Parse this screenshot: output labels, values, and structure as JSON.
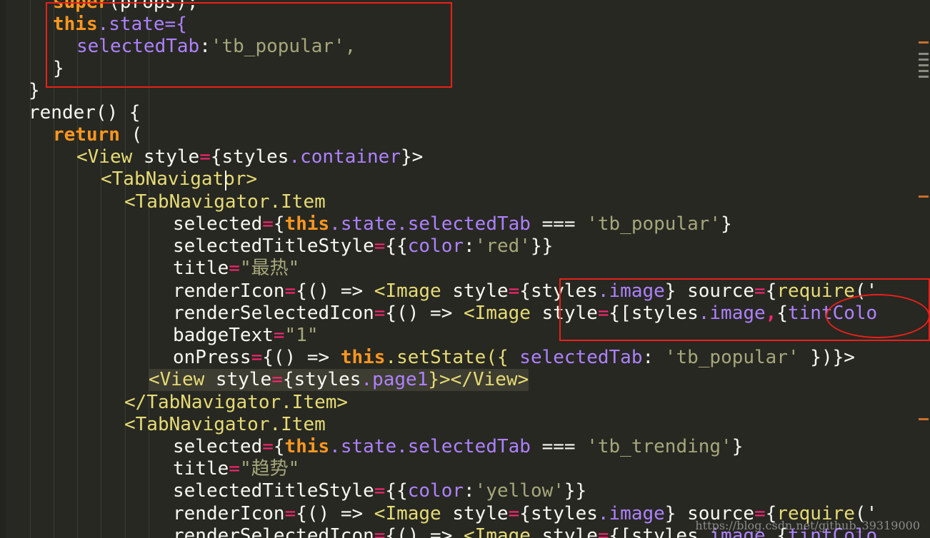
{
  "editor": {
    "lines": {
      "l00_a": "super",
      "l00_b": "(props);",
      "l01_this": "this",
      "l01_rest": ".state={",
      "l02_key": "selectedTab",
      "l02_colon": ":",
      "l02_val": "'tb_popular',",
      "l03": "}",
      "l04": "}",
      "l05": "render() {",
      "l06_kw": "return",
      "l06_rest": " (",
      "l07_open": "<View",
      "l07_attr": " style",
      "l07_eq": "=",
      "l07_a": "{styles",
      "l07_b": ".container",
      "l07_c": "}>",
      "l08_a": "<TabNaviga",
      "l08_b": "tor>",
      "l09": "<TabNavigator.Item",
      "l10_attr": "selected",
      "l10_eq": "=",
      "l10_br": "{",
      "l10_this": "this",
      "l10_prop": ".state.selectedTab",
      "l10_op": " === ",
      "l10_str": "'tb_popular'",
      "l10_end": "}",
      "l11_attr": "selectedTitleStyle",
      "l11_eq": "=",
      "l11_a": "{{",
      "l11_key": "color",
      "l11_colon": ":",
      "l11_str": "'red'",
      "l11_end": "}}",
      "l12_attr": "title",
      "l12_eq": "=",
      "l12_str": "\"最热\"",
      "l13_attr": "renderIcon",
      "l13_eq": "=",
      "l13_a": "{() ",
      "l13_arrow": "=>",
      "l13_b": " <Image",
      "l13_c": " style",
      "l13_eq2": "=",
      "l13_d": "{styles",
      "l13_prop": ".image",
      "l13_e": "} source",
      "l13_eq3": "=",
      "l13_f": "{",
      "l13_req": "require",
      "l13_g": "('",
      "l14_attr": "renderSelectedIcon",
      "l14_eq": "=",
      "l14_a": "{() ",
      "l14_arrow": "=>",
      "l14_b": " <Image",
      "l14_c": " style",
      "l14_eq2": "=",
      "l14_d": "{[styles",
      "l14_prop": ".image",
      "l14_comma": ",",
      "l14_e": "{",
      "l14_tint": "tintColo",
      "l15_attr": "badgeText",
      "l15_eq": "=",
      "l15_str": "\"1\"",
      "l16_attr": "onPress",
      "l16_eq": "=",
      "l16_a": "{() ",
      "l16_arrow": "=>",
      "l16_this": " this",
      "l16_b": ".setState({ ",
      "l16_key": "selectedTab",
      "l16_colon": ": ",
      "l16_str": "'tb_popular'",
      "l16_end": " })}>",
      "l17_open": "<View",
      "l17_attr": " style",
      "l17_eq": "=",
      "l17_a": "{styles",
      "l17_prop": ".page1",
      "l17_b": "}></View>",
      "l18": "</TabNavigator.Item>",
      "l19": "<TabNavigator.Item",
      "l20_attr": "selected",
      "l20_eq": "=",
      "l20_br": "{",
      "l20_this": "this",
      "l20_prop": ".state.selectedTab",
      "l20_op": " === ",
      "l20_str": "'tb_trending'",
      "l20_end": "}",
      "l21_attr": "title",
      "l21_eq": "=",
      "l21_str": "\"趋势\"",
      "l22_attr": "selectedTitleStyle",
      "l22_eq": "=",
      "l22_a": "{{",
      "l22_key": "color",
      "l22_colon": ":",
      "l22_str": "'yellow'",
      "l22_end": "}}",
      "l23_attr": "renderIcon",
      "l23_eq": "=",
      "l23_a": "{() ",
      "l23_arrow": "=>",
      "l23_b": " <Image",
      "l23_c": " style",
      "l23_eq2": "=",
      "l23_d": "{styles",
      "l23_prop": ".image",
      "l23_e": "} source",
      "l23_eq3": "=",
      "l23_f": "{",
      "l23_req": "require",
      "l23_g": "('",
      "l24_attr": "renderSelectedIcon",
      "l24_eq": "=",
      "l24_a": "{() ",
      "l24_arrow": "=>",
      "l24_b": " <Image",
      "l24_c": " style",
      "l24_eq2": "=",
      "l24_d": "{[styles",
      "l24_prop": ".image",
      "l24_comma": ",",
      "l24_e": "{",
      "l24_tint": "tintColo"
    },
    "watermark": "https://blog.csdn.net/github_39319000"
  },
  "colors": {
    "background": "#272822",
    "keyword": "#f92672",
    "this": "#fd971f",
    "property": "#ae81ff",
    "string": "#a6a77a",
    "tag": "#e6db74",
    "annotation": "#e8201a"
  }
}
